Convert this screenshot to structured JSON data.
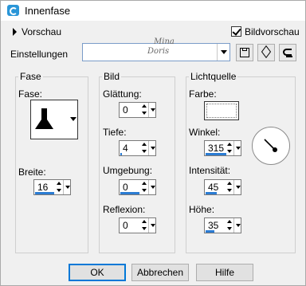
{
  "window": {
    "title": "Innenfase"
  },
  "header": {
    "preview_label": "Vorschau",
    "image_preview_label": "Bildvorschau",
    "image_preview_checked": true
  },
  "settings": {
    "label": "Einstellungen",
    "value": ""
  },
  "watermark": {
    "line1": "Mina",
    "line2": "Doris"
  },
  "fase": {
    "group_label": "Fase",
    "shape_label": "Fase:",
    "width_label": "Breite:",
    "width_value": "16"
  },
  "bild": {
    "group_label": "Bild",
    "smoothness_label": "Glättung:",
    "smoothness_value": "0",
    "depth_label": "Tiefe:",
    "depth_value": "4",
    "ambience_label": "Umgebung:",
    "ambience_value": "0",
    "reflection_label": "Reflexion:",
    "reflection_value": "0"
  },
  "light": {
    "group_label": "Lichtquelle",
    "color_label": "Farbe:",
    "color_value": "#ffffff",
    "angle_label": "Winkel:",
    "angle_value": "315",
    "intensity_label": "Intensität:",
    "intensity_value": "45",
    "elevation_label": "Höhe:",
    "elevation_value": "35"
  },
  "footer": {
    "ok_label": "OK",
    "cancel_label": "Abbrechen",
    "help_label": "Hilfe"
  },
  "colors": {
    "accent": "#2b7cd3",
    "default_button_border": "#0078d7"
  }
}
